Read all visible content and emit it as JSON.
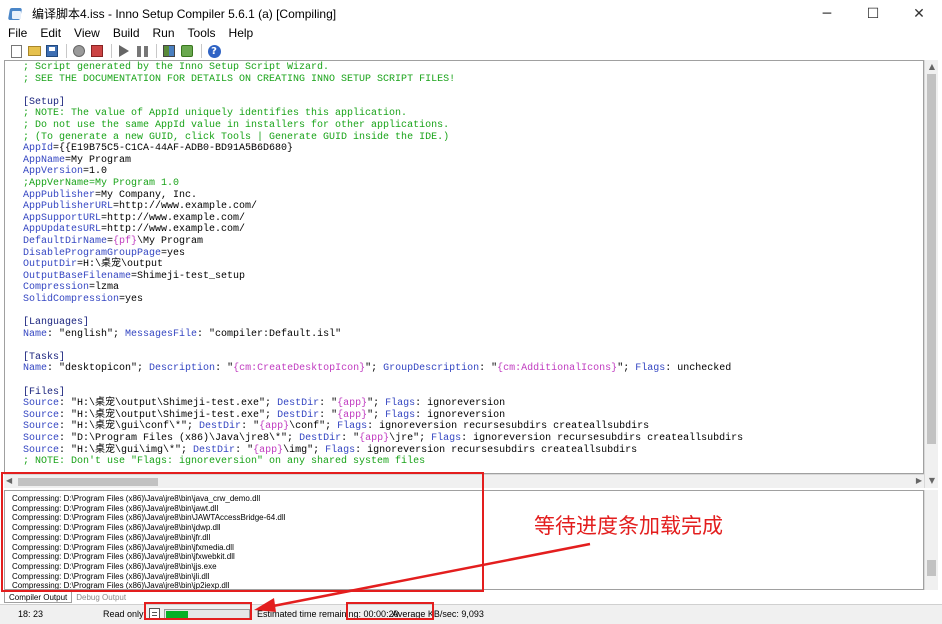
{
  "window": {
    "title": "编译脚本4.iss - Inno Setup Compiler 5.6.1 (a)  [Compiling]",
    "minimize": "─",
    "maximize": "☐",
    "close": "✕"
  },
  "menu": [
    "File",
    "Edit",
    "View",
    "Build",
    "Run",
    "Tools",
    "Help"
  ],
  "toolbar": {
    "buttons": [
      "new-icon",
      "open-icon",
      "save-icon",
      "compile-icon",
      "stop-compile-icon",
      "run-icon",
      "pause-icon",
      "target-icon",
      "wizard-icon",
      "help-icon"
    ]
  },
  "editor": {
    "lines": [
      {
        "kind": "comment",
        "text": "; Script generated by the Inno Setup Script Wizard."
      },
      {
        "kind": "comment",
        "text": "; SEE THE DOCUMENTATION FOR DETAILS ON CREATING INNO SETUP SCRIPT FILES!"
      },
      {
        "kind": "blank",
        "text": ""
      },
      {
        "kind": "section",
        "text": "[Setup]"
      },
      {
        "kind": "comment",
        "text": "; NOTE: The value of AppId uniquely identifies this application."
      },
      {
        "kind": "comment",
        "text": "; Do not use the same AppId value in installers for other applications."
      },
      {
        "kind": "comment",
        "text": "; (To generate a new GUID, click Tools | Generate GUID inside the IDE.)"
      },
      {
        "kind": "kv",
        "key": "AppId",
        "value": "={{E19B75C5-C1CA-44AF-ADB0-BD91A5B6D680}"
      },
      {
        "kind": "kv",
        "key": "AppName",
        "value": "=My Program"
      },
      {
        "kind": "kv",
        "key": "AppVersion",
        "value": "=1.0"
      },
      {
        "kind": "comment",
        "text": ";AppVerName=My Program 1.0"
      },
      {
        "kind": "kv",
        "key": "AppPublisher",
        "value": "=My Company, Inc."
      },
      {
        "kind": "kv",
        "key": "AppPublisherURL",
        "value": "=http://www.example.com/"
      },
      {
        "kind": "kv",
        "key": "AppSupportURL",
        "value": "=http://www.example.com/"
      },
      {
        "kind": "kv",
        "key": "AppUpdatesURL",
        "value": "=http://www.example.com/"
      },
      {
        "kind": "kvdir",
        "key": "DefaultDirName",
        "eq": "=",
        "dir": "{pf}",
        "rest": "\\My Program"
      },
      {
        "kind": "kv",
        "key": "DisableProgramGroupPage",
        "value": "=yes"
      },
      {
        "kind": "kv",
        "key": "OutputDir",
        "value": "=H:\\桌宠\\output"
      },
      {
        "kind": "kv",
        "key": "OutputBaseFilename",
        "value": "=Shimeji-test_setup"
      },
      {
        "kind": "kv",
        "key": "Compression",
        "value": "=lzma"
      },
      {
        "kind": "kv",
        "key": "SolidCompression",
        "value": "=yes"
      },
      {
        "kind": "blank",
        "text": ""
      },
      {
        "kind": "section",
        "text": "[Languages]"
      },
      {
        "kind": "raw",
        "parts": [
          [
            "key",
            "Name"
          ],
          [
            "text",
            ": \"english\"; "
          ],
          [
            "key",
            "MessagesFile"
          ],
          [
            "text",
            ": \"compiler:Default.isl\""
          ]
        ]
      },
      {
        "kind": "blank",
        "text": ""
      },
      {
        "kind": "section",
        "text": "[Tasks]"
      },
      {
        "kind": "raw",
        "parts": [
          [
            "key",
            "Name"
          ],
          [
            "text",
            ": \"desktopicon\"; "
          ],
          [
            "key",
            "Description"
          ],
          [
            "text",
            ": \""
          ],
          [
            "dir",
            "{cm:CreateDesktopIcon}"
          ],
          [
            "text",
            "\"; "
          ],
          [
            "key",
            "GroupDescription"
          ],
          [
            "text",
            ": \""
          ],
          [
            "dir",
            "{cm:AdditionalIcons}"
          ],
          [
            "text",
            "\"; "
          ],
          [
            "key",
            "Flags"
          ],
          [
            "text",
            ": unchecked"
          ]
        ]
      },
      {
        "kind": "blank",
        "text": ""
      },
      {
        "kind": "section",
        "text": "[Files]"
      },
      {
        "kind": "raw",
        "parts": [
          [
            "key",
            "Source"
          ],
          [
            "text",
            ": \"H:\\桌宠\\output\\Shimeji-test.exe\"; "
          ],
          [
            "key",
            "DestDir"
          ],
          [
            "text",
            ": \""
          ],
          [
            "dir",
            "{app}"
          ],
          [
            "text",
            "\"; "
          ],
          [
            "key",
            "Flags"
          ],
          [
            "text",
            ": ignoreversion"
          ]
        ]
      },
      {
        "kind": "raw",
        "parts": [
          [
            "key",
            "Source"
          ],
          [
            "text",
            ": \"H:\\桌宠\\output\\Shimeji-test.exe\"; "
          ],
          [
            "key",
            "DestDir"
          ],
          [
            "text",
            ": \""
          ],
          [
            "dir",
            "{app}"
          ],
          [
            "text",
            "\"; "
          ],
          [
            "key",
            "Flags"
          ],
          [
            "text",
            ": ignoreversion"
          ]
        ]
      },
      {
        "kind": "raw",
        "parts": [
          [
            "key",
            "Source"
          ],
          [
            "text",
            ": \"H:\\桌宠\\gui\\conf\\*\"; "
          ],
          [
            "key",
            "DestDir"
          ],
          [
            "text",
            ": \""
          ],
          [
            "dir",
            "{app}"
          ],
          [
            "text",
            "\\conf\"; "
          ],
          [
            "key",
            "Flags"
          ],
          [
            "text",
            ": ignoreversion recursesubdirs createallsubdirs"
          ]
        ]
      },
      {
        "kind": "raw",
        "parts": [
          [
            "key",
            "Source"
          ],
          [
            "text",
            ": \"D:\\Program Files (x86)\\Java\\jre8\\*\"; "
          ],
          [
            "key",
            "DestDir"
          ],
          [
            "text",
            ": \""
          ],
          [
            "dir",
            "{app}"
          ],
          [
            "text",
            "\\jre\"; "
          ],
          [
            "key",
            "Flags"
          ],
          [
            "text",
            ": ignoreversion recursesubdirs createallsubdirs"
          ]
        ]
      },
      {
        "kind": "raw",
        "parts": [
          [
            "key",
            "Source"
          ],
          [
            "text",
            ": \"H:\\桌宠\\gui\\img\\*\"; "
          ],
          [
            "key",
            "DestDir"
          ],
          [
            "text",
            ": \""
          ],
          [
            "dir",
            "{app}"
          ],
          [
            "text",
            "\\img\"; "
          ],
          [
            "key",
            "Flags"
          ],
          [
            "text",
            ": ignoreversion recursesubdirs createallsubdirs"
          ]
        ]
      },
      {
        "kind": "comment",
        "text": "; NOTE: Don't use \"Flags: ignoreversion\" on any shared system files"
      }
    ]
  },
  "output": {
    "lines": [
      "Compressing: D:\\Program Files (x86)\\Java\\jre8\\bin\\java_crw_demo.dll",
      "Compressing: D:\\Program Files (x86)\\Java\\jre8\\bin\\jawt.dll",
      "Compressing: D:\\Program Files (x86)\\Java\\jre8\\bin\\JAWTAccessBridge-64.dll",
      "Compressing: D:\\Program Files (x86)\\Java\\jre8\\bin\\jdwp.dll",
      "Compressing: D:\\Program Files (x86)\\Java\\jre8\\bin\\jfr.dll",
      "Compressing: D:\\Program Files (x86)\\Java\\jre8\\bin\\jfxmedia.dll",
      "Compressing: D:\\Program Files (x86)\\Java\\jre8\\bin\\jfxwebkit.dll",
      "Compressing: D:\\Program Files (x86)\\Java\\jre8\\bin\\jjs.exe",
      "Compressing: D:\\Program Files (x86)\\Java\\jre8\\bin\\jli.dll",
      "Compressing: D:\\Program Files (x86)\\Java\\jre8\\bin\\jp2iexp.dll"
    ]
  },
  "tabs": {
    "compiler_output": "Compiler Output",
    "debug_output": "Debug Output"
  },
  "status": {
    "position": "18:  23",
    "mode": "Read only",
    "progress_fraction": 0.27,
    "estimate_label": "Estimated time remaining: 00:00:20",
    "speed_label": "Average KB/sec: 9,093"
  },
  "annotation": {
    "text": "等待进度条加载完成",
    "color": "#e31e1e"
  },
  "colors": {
    "comment": "#19a319",
    "keyword": "#3446c2",
    "directive": "#c03cc0",
    "section": "#1a237e",
    "progress": "#06b025"
  }
}
